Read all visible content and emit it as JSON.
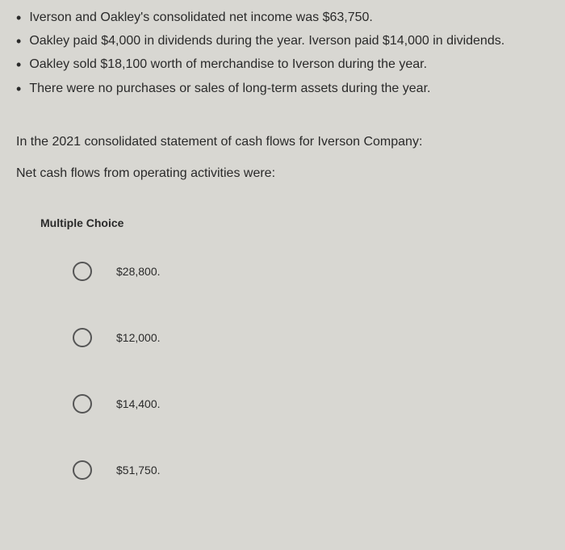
{
  "bullets": [
    "Iverson and Oakley's consolidated net income was $63,750.",
    "Oakley paid $4,000 in dividends during the year. Iverson paid $14,000 in dividends.",
    "Oakley sold $18,100 worth of merchandise to Iverson during the year.",
    "There were no purchases or sales of long-term assets during the year."
  ],
  "prompt": {
    "line1": "In the 2021 consolidated statement of cash flows for Iverson Company:",
    "line2": "Net cash flows from operating activities were:"
  },
  "mc_label": "Multiple Choice",
  "choices": [
    "$28,800.",
    "$12,000.",
    "$14,400.",
    "$51,750."
  ]
}
